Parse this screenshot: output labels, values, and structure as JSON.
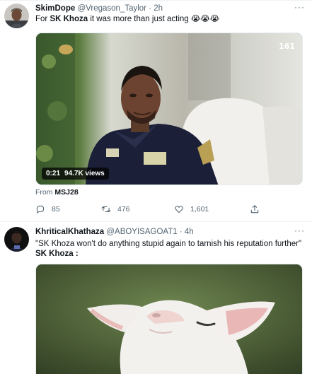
{
  "tweets": [
    {
      "display_name": "SkimDope",
      "handle": "@Vregason_Taylor",
      "separator": "·",
      "time": "2h",
      "text_bold": "SK Khoza",
      "text_prefix": "For ",
      "text_suffix": " it was more than just acting 😭😭😭",
      "video": {
        "duration": "0:21",
        "views": "94.7K views",
        "channel": "161"
      },
      "from_label": "From",
      "from_source": "MSJ28",
      "stats": {
        "replies": "85",
        "retweets": "476",
        "likes": "1,601"
      }
    },
    {
      "display_name": "KhriticalKhathaza",
      "handle": "@ABOYISAGOAT1",
      "separator": "·",
      "time": "4h",
      "text_line1": "\"SK Khoza won't do anything stupid again to tarnish his reputation further\"",
      "text_line2": "SK Khoza :"
    }
  ],
  "icons": {
    "more": "more-horizontal-icon",
    "reply": "reply-icon",
    "retweet": "retweet-icon",
    "like": "heart-icon",
    "share": "share-icon"
  },
  "colors": {
    "text": "#0f1419",
    "muted": "#536471",
    "divider": "#eff3f4"
  }
}
